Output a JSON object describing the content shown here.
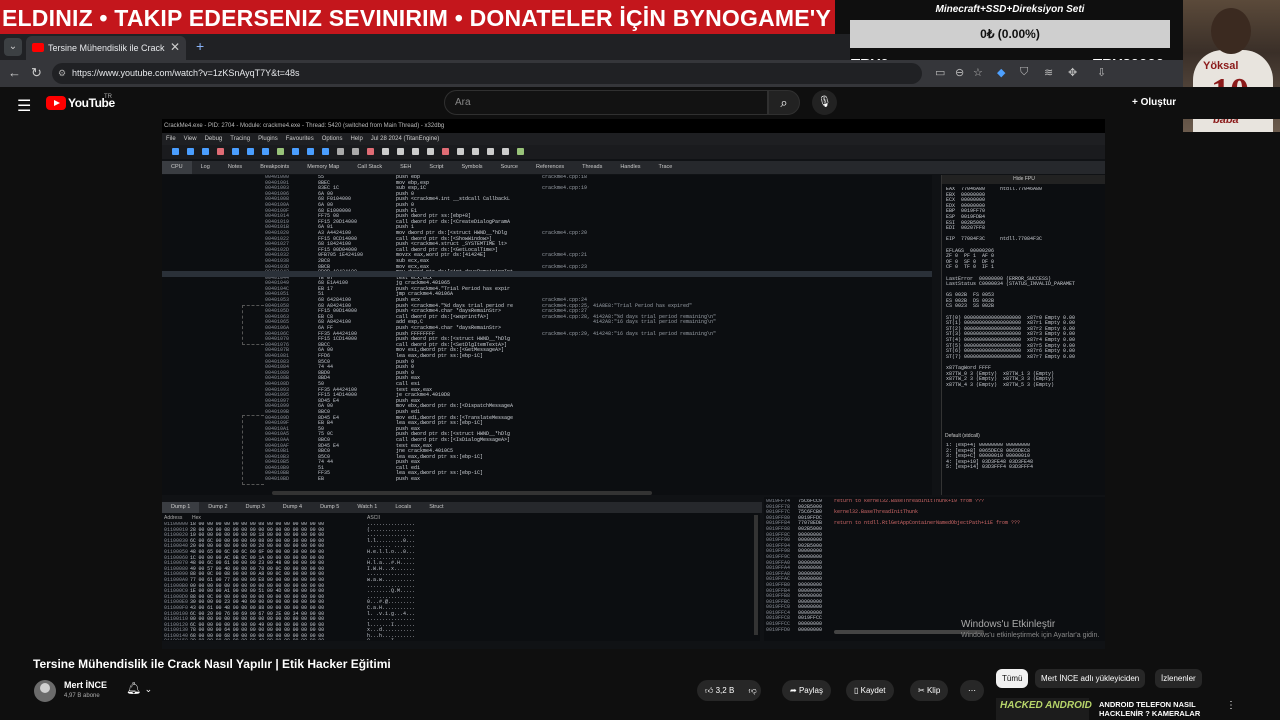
{
  "overlay": {
    "ticker": "ELDINIZ • TAKIP EDERSENIZ SEVINIRIM • DONATELER İÇİN BYNOGAME'Y",
    "goal_title": "Minecraft+SSD+Direksiyon Seti",
    "goal_progress": "0₺ (0.00%)",
    "goal_left": "TRY0",
    "goal_right": "TRY30000",
    "webcam_shirt_name": "Yöksal",
    "webcam_shirt_number": "10",
    "webcam_shirt_text": "baba"
  },
  "browser": {
    "tab_title": "Tersine Mühendislik ile Crack",
    "url": "https://www.youtube.com/watch?v=1zKSnAyqT7Y&t=48s"
  },
  "youtube": {
    "logo": "YouTube",
    "country": "TR",
    "search_placeholder": "Ara",
    "create_label": "Oluştur"
  },
  "debugger": {
    "title_bar": "CrackMe4.exe - PID: 2704 - Module: crackme4.exe - Thread: 5420 (switched from Main Thread) - x32dbg",
    "menu": [
      "File",
      "View",
      "Debug",
      "Tracing",
      "Plugins",
      "Favourites",
      "Options",
      "Help",
      "Jul 28 2024 (TitanEngine)"
    ],
    "tabs": [
      "CPU",
      "Log",
      "Notes",
      "Breakpoints",
      "Memory Map",
      "Call Stack",
      "SEH",
      "Script",
      "Symbols",
      "Source",
      "References",
      "Threads",
      "Handles",
      "Trace"
    ],
    "bottom_tabs": [
      "Dump 1",
      "Dump 2",
      "Dump 3",
      "Dump 4",
      "Dump 5",
      "Watch 1",
      "Locals",
      "Struct"
    ],
    "regs_header": "Hide FPU",
    "stack_header": "Default (stdcall)",
    "dump_header_addr": "Address",
    "dump_header_hex": "Hex",
    "dump_header_ascii": "ASCII",
    "addresses": "00401000\n00401001\n00401003\n00401006\n00401008\n0040100A\n0040100F\n00401014\n00401019\n0040101B\n00401020\n00401022\n00401027\n0040102D\n00401032\n00401038\n0040103D\n00401042\n00401044\n00401049\n0040104C\n00401051\n00401053\n00401058\n0040105D\n00401063\n00401065\n0040106A\n0040106C\n00401070\n00401076\n0040107B\n00401081\n00401083\n00401084\n00401089\n0040108B\n0040108D\n00401093\n00401095\n00401097\n00401099\n0040109B\n0040109D\n0040109F\n004010A1\n004010A5\n004010AA\n004010AF\n004010B1\n004010B3\n004010B5\n004010B9\n004010BB\n004010BD",
    "bytes": "55\n8BEC\n83EC 1C\n6A 00\n68 F0104000\n6A 00\n68 E1000000\nFF75 08\nFF15 20D14000\n6A 01\nA3 A4424100\nFF15 0CD14000\n68 18424100\nFF15 00D04000\n0FB705 1E424100\n2BC8\n8BCB\n8BOD A0424100\n7E 07\n68 E1A4100\nEB 17\n51\n68 64284100\n68 A8424100\nFF15 00D14000\nEB C8\n68 A8424100\n6A FF\nFF35 A4424100\nFF15 1CD14000\n8BCC\n6A 00\nFFD6\n85C0\n74 44\n8BD0\n8BD4\n50\nFF35 A4424100\nFF15 14D14000\n8D45 E4\n6A 00\n8BC0\n8D45 E4\nEB B4\n50\n75 0C\n8BC0\n8D45 E4\n8BC0\n85C0\n74 44\n51\nFF35\nEB",
    "instructions": "push ebp\nmov ebp,esp\nsub esp,1C\npush 0\npush <crackme4.int __stdcall CallbackL\npush 0\npush E1\npush dword ptr ss:[ebp+8]\ncall dword ptr ds:[<CreateDialogParamA\npush 1\nmov dword ptr ds:[<struct HWND__*hDlg\ncall dword ptr ds:[<ShowWindow>]\npush <crackme4.struct _SYSTEMTIME lt>\ncall dword ptr ds:[<GetLocalTime>]\nmovzx eax,word ptr ds:[41424E]\nsub ecx,eax\nmov ecx,eax\nmov dword ptr ds:[<int daysRemainingInt\ntest ecx,ecx\njg crackme4.401065\npush <crackme4.\"Trial Period has expir\njmp crackme4.40106A\npush ecx\npush <crackme4.\"%d days trial period re\npush <crackme4.char *daysRemainStr>\ncall dword ptr ds:[<wsprintfA>]\nadd esp,C\npush <crackme4.char *daysRemainStr>\npush FFFFFFFF\npush dword ptr ds:[<struct HWND__*hDlg\ncall dword ptr ds:[<SetDlgItemTextA>]\nmov esi,dword ptr ds:[<GetMessageA>]\nlea eax,dword ptr ss:[ebp-1C]\npush 0\npush 0\npush 0\npush eax\ncall esi\ntest eax,eax\nje crackme4.4010D8\npush eax\nmov ebx,dword ptr ds:[<DispatchMessageA\npush edi\nmov edi,dword ptr ds:[<TranslateMessage\nlea eax,dword ptr ss:[ebp-1C]\npush eax\npush dword ptr ds:[<struct HWND__*hDlg\ncall dword ptr ds:[<IsDialogMessageA>]\ntest eax,eax\njne crackme4.4010C5\nlea eax,dword ptr ss:[ebp-1C]\npush eax\ncall edi\nlea eax,dword ptr ss:[ebp-1C]\npush eax",
    "comments": "crackme4.cpp:18\n\ncrackme4.cpp:19\n\n\n\n\n\n\n\ncrackme4.cpp:20\n\n\n\ncrackme4.cpp:21\n\ncrackme4.cpp:23\n\n\n\n\n\ncrackme4.cpp:24\ncrackme4.cpp:25, 41A8E8:\"Trial Period has expired\"\ncrackme4.cpp:27\ncrackme4.cpp:28, 4142A8:\"%d days trial period remaining\\n\"\n                 4142A8:\"16 days trial period remaining\\n\"\n\ncrackme4.cpp:29, 414248:\"16 days trial period remaining\\n\"",
    "registers": "EAX  77046A80     ntdll.77046A80\nEBX  00000000\nECX  00000000\nEDX  00000000\nEBP  0019FF70\nESP  0019FDB4\nESI  002B5000\nEDI  00207FF8\n\nEIP  77084F3C     ntdll.77084F3C\n\nEFLAGS  00000206\nZF 0  PF 1  AF 0\nOF 0  SF 0  DF 0\nCF 0  TF 0  IF 1\n\nLastError  00000000 (ERROR_SUCCESS)\nLastStatus C0000034 (STATUS_INVALID_PARAMET\n\nGS 002B  FS 0053\nES 002B  DS 002B\nCS 0023  SS 002B\n\nST(0) 0000000000000000000  x87r0 Empty 0.00\nST(1) 0000000000000000000  x87r1 Empty 0.00\nST(2) 0000000000000000000  x87r2 Empty 0.00\nST(3) 0000000000000000000  x87r3 Empty 0.00\nST(4) 0000000000000000000  x87r4 Empty 0.00\nST(5) 0000000000000000000  x87r5 Empty 0.00\nST(6) 0000000000000000000  x87r6 Empty 0.00\nST(7) 0000000000000000000  x87r7 Empty 0.00\n\nx87TagWord FFFF\nx87TW_0 3 (Empty)  x87TW_1 3 (Empty)\nx87TW_2 3 (Empty)  x87TW_3 3 (Empty)\nx87TW_4 3 (Empty)  x87TW_5 3 (Empty)",
    "stack_args": "1: [esp+4] 00000000 00000000\n2: [esp+8] 0065DEC8 0065DEC8\n3: [esp+C] 00000010 00000010\n4: [esp+10] 03D3FE48 03D3FE48\n5: [esp+14] 03D3FFF4 03D3FFF4",
    "dump_addr": "01100000\n01100010\n01100020\n01100030\n01100040\n01100050\n01100060\n01100070\n01100080\n01100090\n011000A0\n011000B0\n011000C0\n011000D0\n011000E0\n011000F0\n01100100\n01100110\n01100120\n01100130\n01100140\n01100150\n01100160",
    "dump_hex": "18 00 00 00 00 00 00 00 08 00 00 00 00 00 00 00\n28 00 00 00 08 00 00 00 00 00 00 00 00 00 00 00\n10 00 00 00 00 00 00 00 18 00 00 00 00 00 00 00\n6C 00 6C 00 00 00 00 00 08 00 00 00 30 00 00 00\n20 00 00 00 00 00 00 00 20 00 00 00 00 00 00 00\n48 00 65 00 6C 00 6C 00 6F 00 00 00 30 00 00 00\n1C 00 00 00 AC 0B 0C 00 1A 00 00 00 00 00 00 00\n48 00 6C 00 61 00 00 00 23 00 48 00 00 00 00 00\n49 00 57 00 48 00 00 00 78 00 0C 00 00 00 00 00\n88 00 0C 00 08 00 00 00 A8 00 0C 00 00 00 00 00\n77 00 61 00 77 00 00 00 E8 00 00 00 00 00 00 00\n00 00 00 00 00 00 00 00 00 00 00 00 00 00 00 00\n1E 00 00 00 A1 00 00 00 51 00 4D 00 00 00 00 00\n88 00 0C 00 00 00 00 00 00 00 00 00 00 00 00 00\n30 00 00 00 23 00 40 00 00 00 00 00 00 00 00 00\n43 00 61 00 48 00 00 00 88 00 00 00 00 00 00 00\n6C 00 20 00 76 00 69 00 67 00 2E 00 34 00 00 00\n00 00 00 00 00 00 00 00 00 00 00 00 00 00 00 00\n6C 00 00 00 00 00 00 00 49 00 00 00 00 00 00 00\n78 00 00 00 64 00 00 00 00 00 00 00 00 00 00 00\n68 00 00 00 68 00 00 00 00 00 00 00 00 00 00 00\n30 00 00 00 00 00 00 00 49 00 00 00 00 00 00 00\n00 00 00 00 00 00 00 00 00 00 00 00 00 00 00 00",
    "dump_ascii": "................\n(...............\n................\nl.l.........0...\n ....... .......\nH.e.l.l.o...0...\n................\nH.l.a...#.H.....\nI.W.H...x.......\n................\nw.a.w...........\n................\n........Q.M.....\n................\n0...#.@.........\nC.a.H...........\nl. .v.i.g...4...\n................\nl.......I.......\nx...d...........\nh...h...........\n0.......I.......\n................",
    "stack_addr": "0019FF74\n0019FF78\n0019FF7C\n0019FF80\n0019FF84\n0019FF88\n0019FF8C\n0019FF90\n0019FF94\n0019FF98\n0019FF9C\n0019FFA0\n0019FFA4\n0019FFA8\n0019FFAC\n0019FFB0\n0019FFB4\n0019FFB8\n0019FFBC\n0019FFC0\n0019FFC4\n0019FFC8\n0019FFCC\n0019FFD0",
    "stack_vals": "75C6FCC9\n002B5000\n75C6FCB0\n0019FFDC\n77078EDB\n002B5000\n00000000\n00000000\n002B5000\n00000000\n00000000\n00000000\n00000000\n00000000\n00000000\n00000000\n00000000\n00000000\n00000000\n00000000\n00000000\n0019FFCC\n00000000\n00000000",
    "stack_comments": "return to kernel32.BaseThreadInitThunk+19 from ???\n\nkernel32.BaseThreadInitThunk\n\nreturn to ntdll.RtlGetAppContainerNamedObjectPath+11E from ???"
  },
  "windows_watermark": {
    "title": "Windows'u Etkinleştir",
    "subtitle": "Windows'u etkinleştirmek için Ayarlar'a gidin."
  },
  "video_info": {
    "title": "Tersine Mühendislik ile Crack Nasıl Yapılır | Etik Hacker Eğitimi",
    "channel": "Mert İNCE",
    "subscribers": "4,97 B abone",
    "likes": "3,2 B",
    "share": "Paylaş",
    "save": "Kaydet",
    "clip": "Klip"
  },
  "chips": [
    "Tümü",
    "Mert İNCE adlı yükleyiciden",
    "İzlenenler"
  ],
  "recommended": {
    "thumb_label": "HACKED ANDROID",
    "title": "ANDROID TELEFON NASIL HACKLENİR ? KAMERALAR"
  },
  "colors": {
    "ticker_bg": "#c4161c",
    "youtube_red": "#ff0000",
    "debugger_red": "#e06c75",
    "debugger_green": "#98c379",
    "debugger_blue": "#61afef"
  }
}
